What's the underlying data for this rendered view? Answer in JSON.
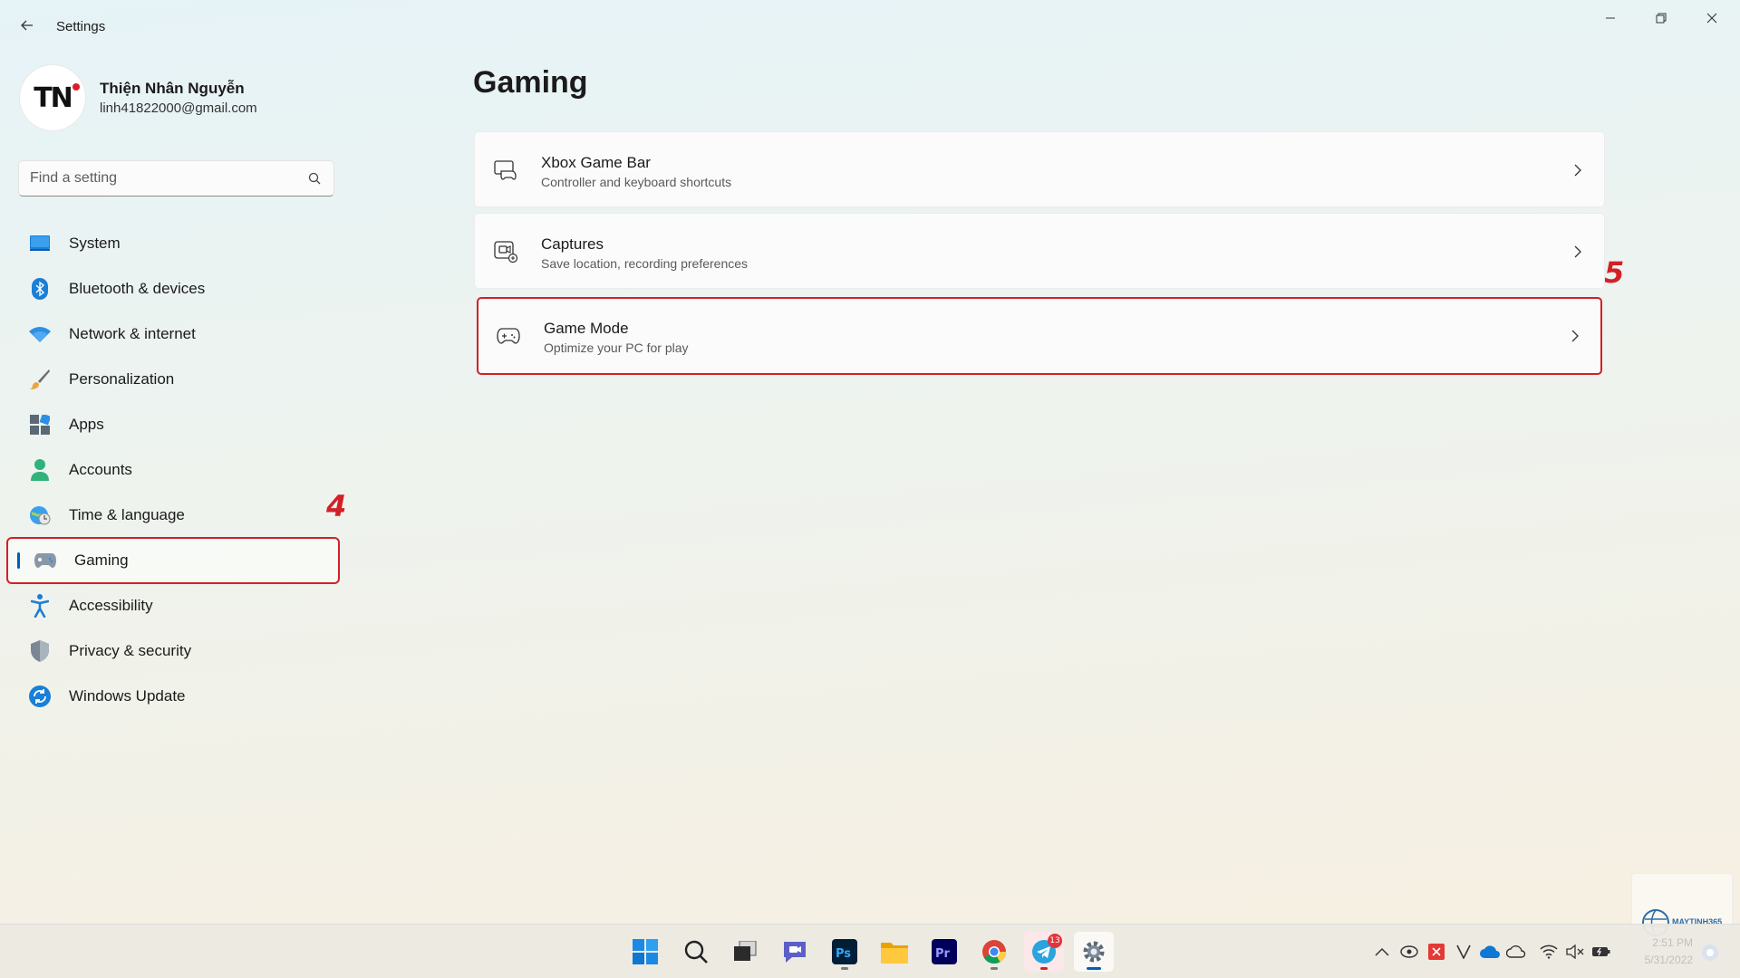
{
  "window": {
    "title": "Settings"
  },
  "profile": {
    "name": "Thiện Nhân Nguyễn",
    "email": "linh41822000@gmail.com",
    "initials": "TN"
  },
  "search": {
    "placeholder": "Find a setting"
  },
  "nav": {
    "items": [
      {
        "label": "System",
        "icon": "monitor-icon"
      },
      {
        "label": "Bluetooth & devices",
        "icon": "bluetooth-icon"
      },
      {
        "label": "Network & internet",
        "icon": "wifi-icon"
      },
      {
        "label": "Personalization",
        "icon": "brush-icon"
      },
      {
        "label": "Apps",
        "icon": "apps-icon"
      },
      {
        "label": "Accounts",
        "icon": "person-icon"
      },
      {
        "label": "Time & language",
        "icon": "globe-clock-icon"
      },
      {
        "label": "Gaming",
        "icon": "gamepad-icon",
        "active": true
      },
      {
        "label": "Accessibility",
        "icon": "accessibility-icon"
      },
      {
        "label": "Privacy & security",
        "icon": "shield-icon"
      },
      {
        "label": "Windows Update",
        "icon": "sync-icon"
      }
    ]
  },
  "annotations": {
    "step4": "4",
    "step5": "5"
  },
  "main": {
    "title": "Gaming",
    "cards": [
      {
        "title": "Xbox Game Bar",
        "subtitle": "Controller and keyboard shortcuts",
        "icon": "game-bar-icon"
      },
      {
        "title": "Captures",
        "subtitle": "Save location, recording preferences",
        "icon": "capture-icon"
      },
      {
        "title": "Game Mode",
        "subtitle": "Optimize your PC for play",
        "icon": "gamepad-icon",
        "highlighted": true
      }
    ]
  },
  "taskbar": {
    "apps": [
      "windows-start-icon",
      "search-icon",
      "task-view-icon",
      "teams-chat-icon",
      "photoshop-icon",
      "file-explorer-icon",
      "premiere-icon",
      "chrome-icon",
      "telegram-icon",
      "settings-gear-icon"
    ],
    "telegram_badge": "13",
    "clock_time": "2:51 PM",
    "clock_date": "5/31/2022",
    "watermark": "MAYTINH365"
  },
  "colors": {
    "accent": "#005fb8",
    "annotation": "#d32027"
  }
}
